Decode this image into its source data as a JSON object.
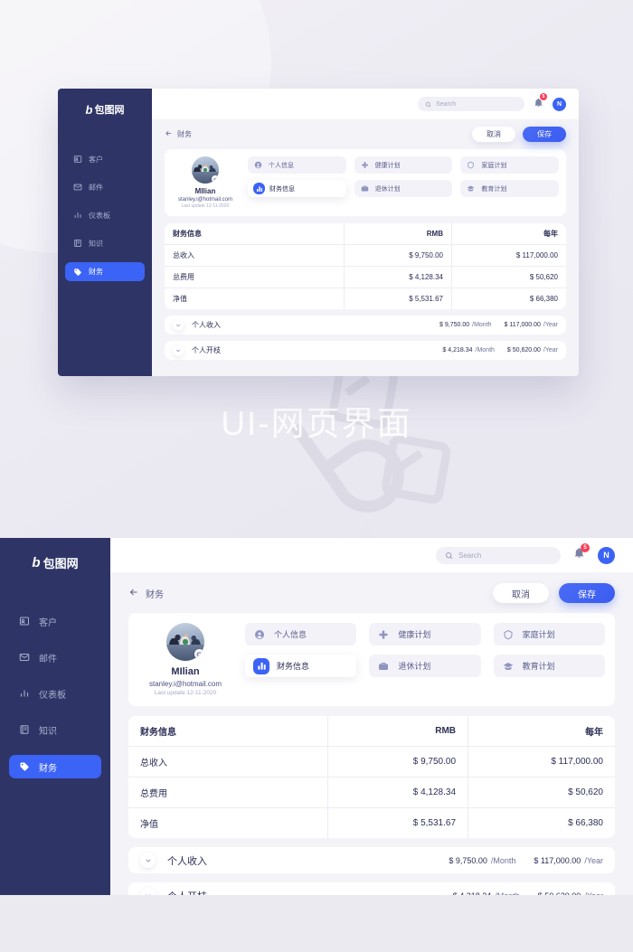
{
  "poster": {
    "title": "UI-网页界面",
    "watermark_icon": "baotu-watermark-icon"
  },
  "colors": {
    "sidebar": "#2e3566",
    "accent": "#3b63f6",
    "positive": "#13d2a4",
    "badge": "#f8415a",
    "page_bg": "#eceaf1"
  },
  "app": {
    "logo": {
      "mark": "b",
      "text": "包图网"
    },
    "sidebar": {
      "items": [
        {
          "label": "客户",
          "icon": "contact-card-icon",
          "active": false
        },
        {
          "label": "邮件",
          "icon": "envelope-icon",
          "active": false
        },
        {
          "label": "仪表板",
          "icon": "bar-chart-icon",
          "active": false
        },
        {
          "label": "知识",
          "icon": "book-icon",
          "active": false
        },
        {
          "label": "财务",
          "icon": "tag-icon",
          "active": true
        }
      ]
    },
    "topbar": {
      "search_placeholder": "Search",
      "search_value": "",
      "search_icon": "search-icon",
      "bell_icon": "bell-icon",
      "notification_count": "5",
      "avatar_initial": "N"
    },
    "subbar": {
      "back_icon": "arrow-left-icon",
      "breadcrumb": "财务",
      "cancel_label": "取消",
      "save_label": "保存"
    },
    "profile": {
      "name": "MIlian",
      "email": "stanley.i@hotmail.com",
      "last_update": "Last update 12-11-2020",
      "camera_icon": "camera-icon",
      "avatar_image": "team-photo"
    },
    "options": [
      {
        "label": "个人信息",
        "icon": "user-circle-icon",
        "active": false
      },
      {
        "label": "健康计划",
        "icon": "plus-cross-icon",
        "active": false
      },
      {
        "label": "家庭计划",
        "icon": "home-shield-icon",
        "active": false
      },
      {
        "label": "财务信息",
        "icon": "bar-chart-icon",
        "active": true
      },
      {
        "label": "退休计划",
        "icon": "briefcase-icon",
        "active": false
      },
      {
        "label": "教育计划",
        "icon": "graduation-icon",
        "active": false
      }
    ],
    "finance_table": {
      "headers": [
        "财务信息",
        "RMB",
        "每年"
      ],
      "rows": [
        {
          "label": "总收入",
          "rmb": "$ 9,750.00",
          "year": "$ 117,000.00",
          "highlight": false
        },
        {
          "label": "总费用",
          "rmb": "$ 4,128.34",
          "year": "$ 50,620",
          "highlight": false
        },
        {
          "label": "净值",
          "rmb": "$ 5,531.67",
          "year": "$ 66,380",
          "highlight": true
        }
      ]
    },
    "expandables": [
      {
        "label": "个人收入",
        "chevron_icon": "chevron-down-icon",
        "month_value": "$ 9,750.00",
        "month_unit": "/Month",
        "year_value": "$ 117,000.00",
        "year_unit": "/Year"
      },
      {
        "label": "个人开枝",
        "chevron_icon": "chevron-down-icon",
        "month_value": "$ 4,218.34",
        "month_unit": "/Month",
        "year_value": "$ 50,620.00",
        "year_unit": "/Year"
      }
    ]
  }
}
